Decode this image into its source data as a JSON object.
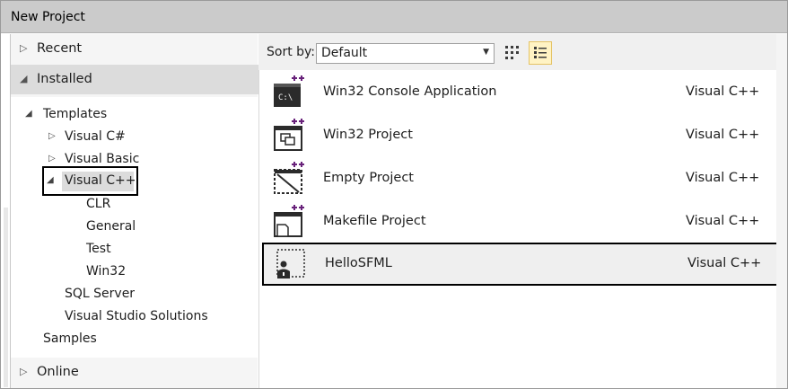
{
  "window": {
    "title": "New Project"
  },
  "left": {
    "recent": "Recent",
    "installed": "Installed",
    "online": "Online",
    "tree": [
      {
        "label": "Templates",
        "glyph": "expanded"
      },
      {
        "label": "Visual C#",
        "glyph": "collapsed"
      },
      {
        "label": "Visual Basic",
        "glyph": "collapsed"
      },
      {
        "label": "Visual C++",
        "glyph": "expanded",
        "selected": true
      },
      {
        "label": "CLR"
      },
      {
        "label": "General"
      },
      {
        "label": "Test"
      },
      {
        "label": "Win32"
      },
      {
        "label": "SQL Server"
      },
      {
        "label": "Visual Studio Solutions"
      },
      {
        "label": "Samples"
      }
    ]
  },
  "toolbar": {
    "sort_label": "Sort by:",
    "sort_value": "Default",
    "views": [
      "grid-view-icon",
      "list-view-icon"
    ],
    "active_view": "list"
  },
  "templates": [
    {
      "name": "Win32 Console Application",
      "lang": "Visual C++",
      "icon": "console-app-icon"
    },
    {
      "name": "Win32 Project",
      "lang": "Visual C++",
      "icon": "win32-project-icon"
    },
    {
      "name": "Empty Project",
      "lang": "Visual C++",
      "icon": "empty-project-icon"
    },
    {
      "name": "Makefile Project",
      "lang": "Visual C++",
      "icon": "makefile-project-icon"
    },
    {
      "name": "HelloSFML",
      "lang": "Visual C++",
      "icon": "custom-template-icon",
      "selected": true
    }
  ],
  "colors": {
    "cpp_plus": "#68217a",
    "selection": "#dcdcdc",
    "view_active": "#fff3c4"
  }
}
